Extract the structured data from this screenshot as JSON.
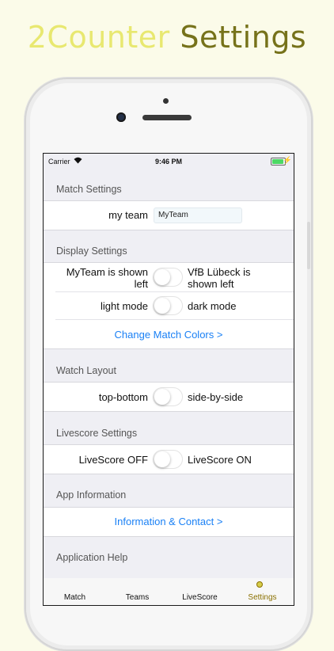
{
  "headline": {
    "word1": "2Counter",
    "word2": "Settings"
  },
  "status_bar": {
    "carrier": "Carrier",
    "time": "9:46 PM"
  },
  "sections": {
    "match": {
      "header": "Match Settings",
      "team_label": "my team",
      "team_value": "MyTeam"
    },
    "display": {
      "header": "Display Settings",
      "side_left": "MyTeam is shown left",
      "side_right": "VfB Lübeck is shown left",
      "mode_left": "light mode",
      "mode_right": "dark mode",
      "colors_link": "Change Match Colors >"
    },
    "watch": {
      "header": "Watch Layout",
      "layout_left": "top-bottom",
      "layout_right": "side-by-side"
    },
    "livescore": {
      "header": "Livescore Settings",
      "left": "LiveScore OFF",
      "right": "LiveScore ON"
    },
    "app_info": {
      "header": "App Information",
      "link": "Information & Contact  >"
    },
    "help": {
      "header": "Application Help"
    }
  },
  "tabs": [
    {
      "label": "Match"
    },
    {
      "label": "Teams"
    },
    {
      "label": "LiveScore"
    },
    {
      "label": "Settings",
      "active": true
    }
  ],
  "colors": {
    "accent": "#1a80f5",
    "active_tab": "#8a7000",
    "headline_light": "#e8e870",
    "headline_dark": "#76721a"
  },
  "toggles": {
    "side": false,
    "mode": false,
    "layout": false,
    "livescore": false
  }
}
